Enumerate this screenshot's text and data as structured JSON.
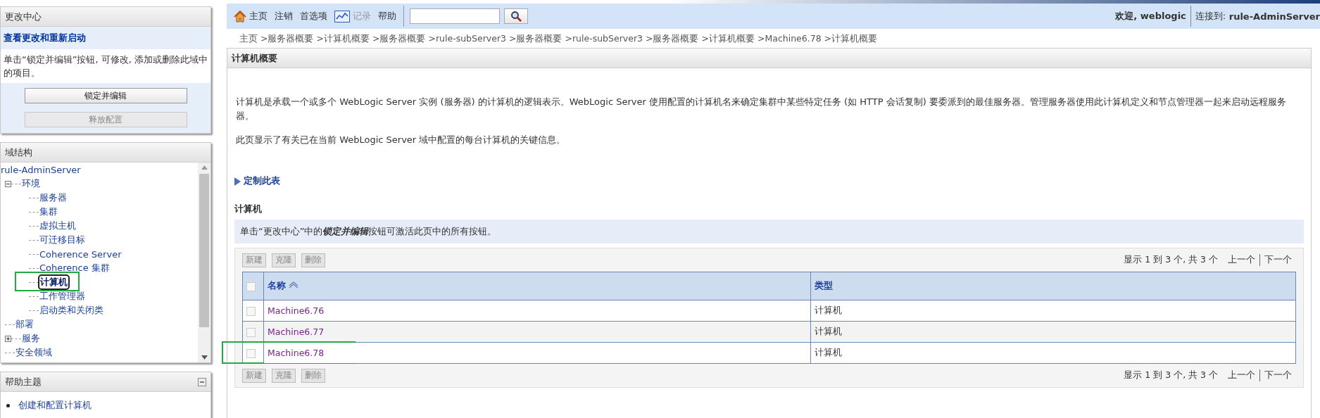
{
  "change_center": {
    "title": "更改中心",
    "link": "查看更改和重新启动",
    "message": "单击“锁定并编辑”按钮, 可修改, 添加或删除此域中的项目。",
    "buttons": [
      {
        "label": "锁定并编辑",
        "disabled": false
      },
      {
        "label": "释放配置",
        "disabled": true
      }
    ]
  },
  "domain_structure": {
    "title": "域结构",
    "tree": [
      {
        "label": "rule-AdminServer",
        "selected": false,
        "highlighted": false,
        "children": [
          {
            "label": "环境",
            "expanded": true,
            "selected": false,
            "highlighted": false,
            "children": [
              {
                "label": "服务器",
                "selected": false,
                "highlighted": false
              },
              {
                "label": "集群",
                "selected": false,
                "highlighted": false
              },
              {
                "label": "虚拟主机",
                "selected": false,
                "highlighted": false
              },
              {
                "label": "可迁移目标",
                "selected": false,
                "highlighted": false
              },
              {
                "label": "Coherence Server",
                "selected": false,
                "highlighted": false
              },
              {
                "label": "Coherence 集群",
                "selected": false,
                "highlighted": false
              },
              {
                "label": "计算机",
                "selected": true,
                "highlighted": true
              },
              {
                "label": "工作管理器",
                "selected": false,
                "highlighted": false
              },
              {
                "label": "启动类和关闭类",
                "selected": false,
                "highlighted": false
              }
            ]
          },
          {
            "label": "部署",
            "selected": false,
            "highlighted": false
          },
          {
            "label": "服务",
            "expanded": false,
            "selected": false,
            "highlighted": false
          },
          {
            "label": "安全领域",
            "selected": false,
            "highlighted": false
          }
        ]
      }
    ]
  },
  "help_topics": {
    "title": "帮助主题",
    "items": [
      "创建和配置计算机"
    ]
  },
  "toolbar": {
    "items": [
      {
        "label": "主页",
        "kind": "home",
        "disabled": false
      },
      {
        "label": "注销",
        "kind": "plain",
        "disabled": false
      },
      {
        "label": "首选项",
        "kind": "plain",
        "disabled": false
      },
      {
        "label": "记录",
        "kind": "record",
        "disabled": true
      },
      {
        "label": "帮助",
        "kind": "plain",
        "disabled": false
      }
    ],
    "welcome": "欢迎, weblogic",
    "connected_label": "连接到:",
    "connected_server": "rule-AdminServer"
  },
  "breadcrumb": [
    "主页",
    ">服务器概要",
    ">计算机概要",
    ">服务器概要",
    ">rule-subServer3",
    ">服务器概要",
    ">rule-subServer3",
    ">服务器概要",
    ">计算机概要",
    ">Machine6.78",
    ">计算机概要"
  ],
  "content": {
    "title": "计算机概要",
    "paragraphs": [
      "计算机是承载一个或多个 WebLogic Server 实例 (服务器) 的计算机的逻辑表示。WebLogic Server 使用配置的计算机名来确定集群中某些特定任务 (如 HTTP 会话复制) 要委派到的最佳服务器。管理服务器使用此计算机定义和节点管理器一起来启动远程服务器。",
      "此页显示了有关已在当前 WebLogic Server 域中配置的每台计算机的关键信息。"
    ],
    "customize_link": "定制此表",
    "table_title": "计算机",
    "notice": {
      "before": "单击“更改中心”中的",
      "emphasis": "锁定并编辑",
      "after": "按钮可激活此页中的所有按钮。"
    },
    "table_buttons": [
      {
        "label": "新建",
        "disabled": true
      },
      {
        "label": "克隆",
        "disabled": true
      },
      {
        "label": "删除",
        "disabled": true
      }
    ],
    "pagination": {
      "summary": "显示 1 到 3 个, 共 3 个",
      "previous": "上一个",
      "next": "下一个"
    },
    "bottom_table_buttons": [
      {
        "label": "新建",
        "disabled": true
      },
      {
        "label": "克隆",
        "disabled": true
      },
      {
        "label": "删除",
        "disabled": true
      }
    ],
    "bottom_pagination": {
      "summary": "显示 1 到 3 个, 共 3 个",
      "previous": "上一个",
      "next": "下一个"
    },
    "select_all_checked": false,
    "columns": [
      {
        "label": "名称",
        "sorted": true
      },
      {
        "label": "类型",
        "sorted": false
      }
    ],
    "rows": [
      {
        "name": "Machine6.76",
        "type": "计算机",
        "checked": false,
        "highlighted": false
      },
      {
        "name": "Machine6.77",
        "type": "计算机",
        "checked": false,
        "highlighted": false
      },
      {
        "name": "Machine6.78",
        "type": "计算机",
        "checked": false,
        "highlighted": true
      }
    ]
  }
}
